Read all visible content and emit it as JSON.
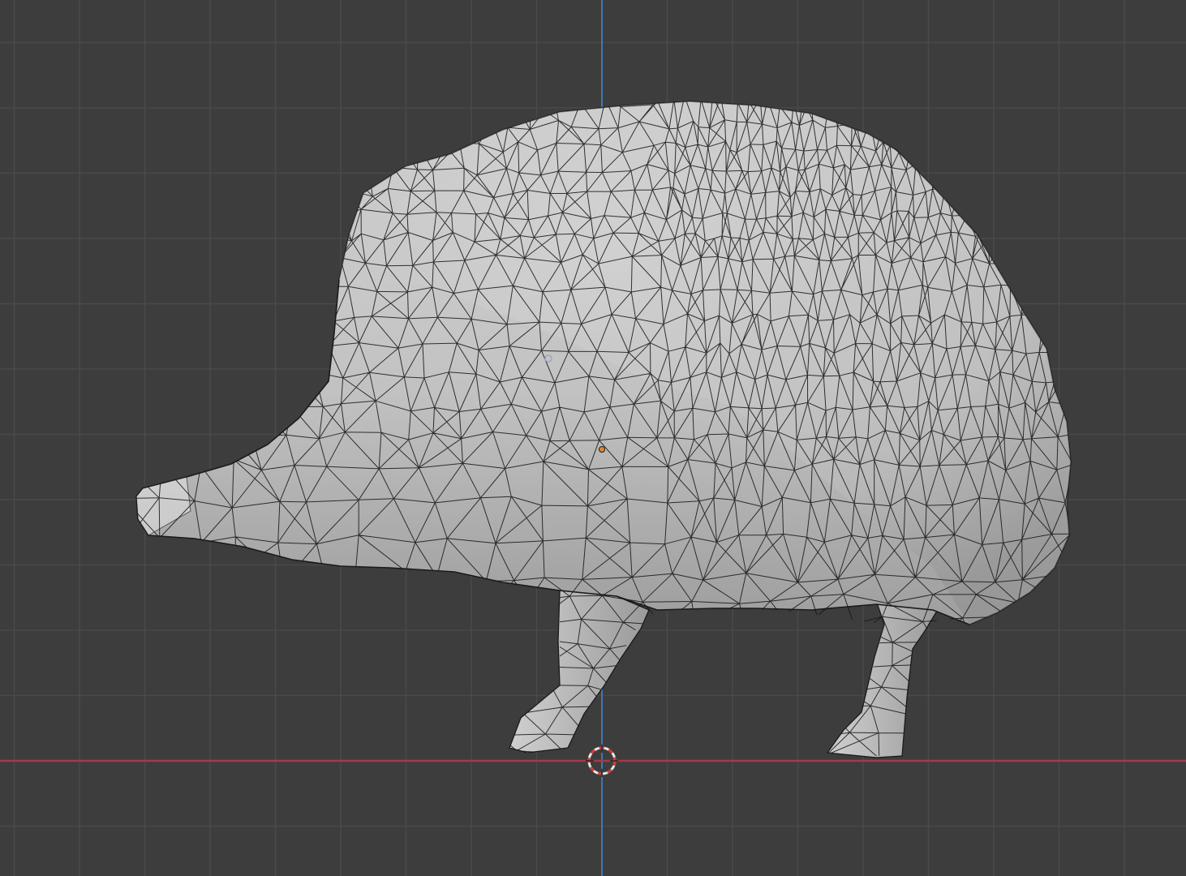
{
  "viewport": {
    "view": "3D Viewport",
    "background_color": "#3d3d3d",
    "grid_color": "#4a4a4a",
    "x_axis_color": "#a6394a",
    "z_axis_color": "#3f78b3",
    "shading": "solid-with-wireframe-overlay"
  },
  "scene": {
    "object_name": "hedgehog-mesh",
    "mesh_color": "#c8c8c8",
    "edge_color": "#1a1a1a",
    "origin_color": "#e08a2c",
    "cursor_colors": [
      "#e8e8e8",
      "#d23a3a"
    ]
  }
}
